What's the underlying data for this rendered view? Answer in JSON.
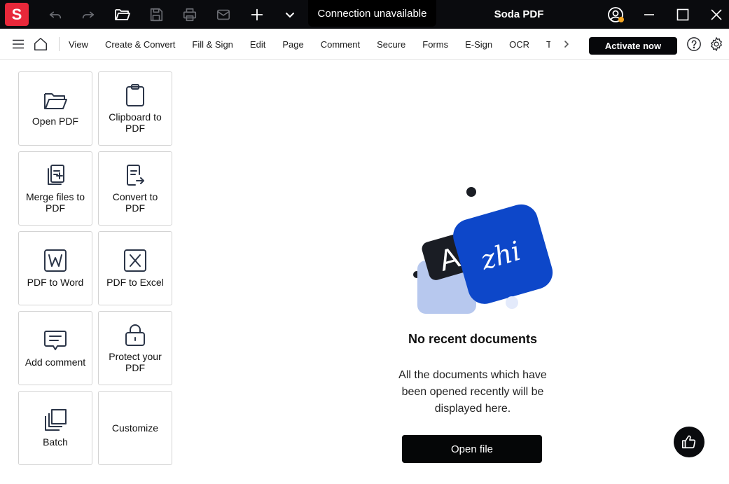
{
  "titlebar": {
    "logo_letter": "S",
    "connection_tooltip": "Connection unavailable",
    "app_title": "Soda PDF",
    "icons": [
      "undo-icon",
      "redo-icon",
      "open-folder-icon",
      "save-icon",
      "print-icon",
      "mail-icon",
      "plus-icon",
      "chevron-down-icon",
      "user-account-icon",
      "minimize-icon",
      "maximize-icon",
      "close-icon"
    ],
    "status_dot_color": "#f5a623"
  },
  "menubar": {
    "items": [
      {
        "label": "View"
      },
      {
        "label": "Create & Convert"
      },
      {
        "label": "Fill & Sign"
      },
      {
        "label": "Edit"
      },
      {
        "label": "Page"
      },
      {
        "label": "Comment"
      },
      {
        "label": "Secure"
      },
      {
        "label": "Forms"
      },
      {
        "label": "E-Sign"
      },
      {
        "label": "OCR"
      },
      {
        "label": "T"
      }
    ],
    "activate_label": "Activate now",
    "icons": [
      "hamburger-menu-icon",
      "home-icon",
      "chevron-right-icon",
      "help-icon",
      "settings-gear-icon"
    ]
  },
  "tiles": [
    {
      "label": "Open PDF",
      "icon": "folder-open-icon"
    },
    {
      "label": "Clipboard to PDF",
      "icon": "clipboard-icon"
    },
    {
      "label": "Merge files to PDF",
      "icon": "merge-files-icon"
    },
    {
      "label": "Convert to PDF",
      "icon": "convert-document-icon"
    },
    {
      "label": "PDF to Word",
      "icon": "word-icon"
    },
    {
      "label": "PDF to Excel",
      "icon": "excel-icon"
    },
    {
      "label": "Add comment",
      "icon": "comment-icon"
    },
    {
      "label": "Protect your PDF",
      "icon": "lock-icon"
    },
    {
      "label": "Batch",
      "icon": "batch-icon"
    },
    {
      "label": "Customize",
      "icon": ""
    }
  ],
  "empty_state": {
    "title": "No recent documents",
    "description": "All the documents which have been opened recently will be displayed here.",
    "illustration_letter": "A",
    "signature_text": "zhi",
    "open_file_label": "Open file",
    "colors": {
      "blue": "#0d47c9",
      "light_blue": "#b7c8ee",
      "dark": "#1a1d24"
    }
  },
  "feedback_icon": "thumbs-up-icon"
}
